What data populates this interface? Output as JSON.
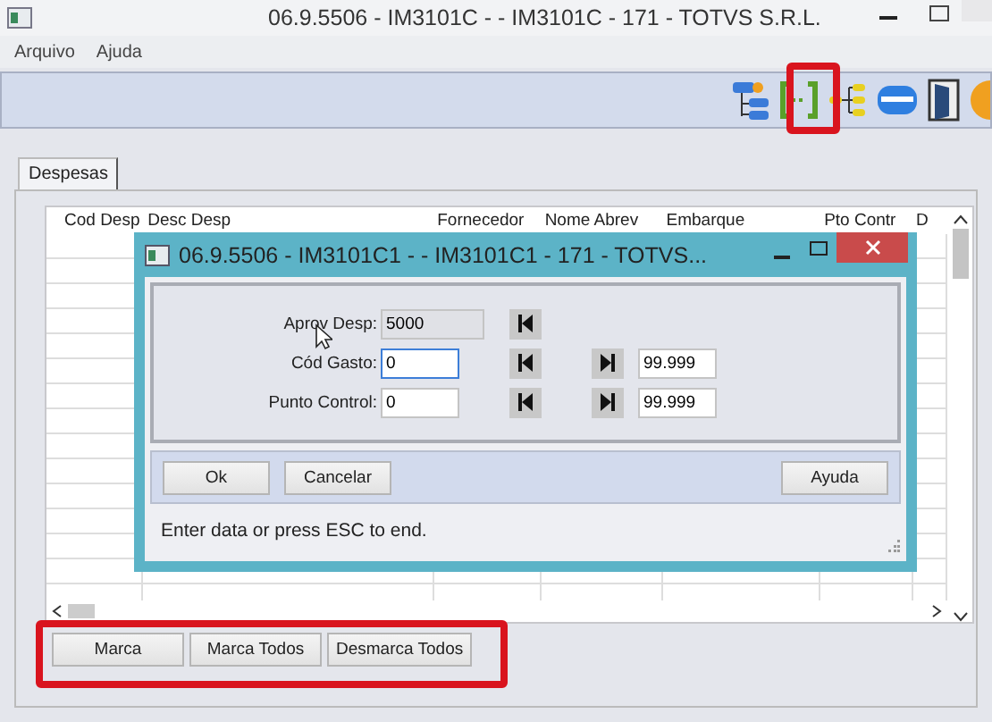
{
  "window": {
    "title": "06.9.5506 - IM3101C -  - IM3101C - 171 - TOTVS S.R.L."
  },
  "menu": [
    "Arquivo",
    "Ajuda"
  ],
  "tabs": [
    {
      "label": "Despesas",
      "selected": true
    }
  ],
  "table": {
    "columns": [
      "Cod Desp",
      "Desc Desp",
      "Fornecedor",
      "Nome Abrev",
      "Embarque",
      "Pto Contr",
      "D"
    ]
  },
  "dialog": {
    "title": "06.9.5506 - IM3101C1 -  - IM3101C1 - 171 - TOTVS...",
    "fields": [
      {
        "label": "Aprov Desp:",
        "value": "5000",
        "disabled": true,
        "focused": false
      },
      {
        "label": "Cód Gasto:",
        "value": "0",
        "disabled": false,
        "focused": true,
        "end_value": "99.999"
      },
      {
        "label": "Punto Control:",
        "value": "0",
        "disabled": false,
        "focused": false,
        "end_value": "99.999"
      }
    ],
    "buttons": [
      "Ok",
      "Cancelar"
    ],
    "help_button": "Ayuda",
    "status": "Enter data or press ESC to end."
  },
  "buttons": [
    "Marca",
    "Marca Todos",
    "Desmarca Todos"
  ]
}
